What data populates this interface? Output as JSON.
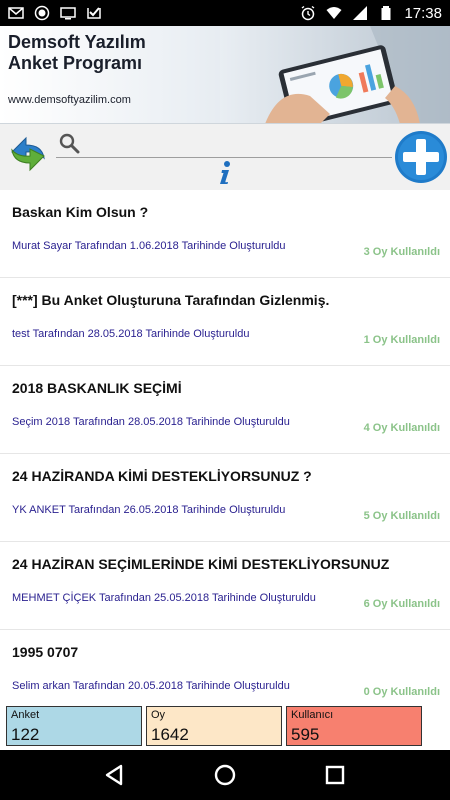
{
  "status_bar": {
    "time": "17:38"
  },
  "banner": {
    "title_line1": "Demsoft Yazılım",
    "title_line2": "Anket Programı",
    "url": "www.demsoftyazilim.com"
  },
  "search": {
    "placeholder": ""
  },
  "surveys": [
    {
      "title": "Baskan Kim Olsun ?",
      "subtitle": "Murat Sayar Tarafından 1.06.2018 Tarihinde Oluşturuldu",
      "votes": "3 Oy Kullanıldı"
    },
    {
      "title": "[***] Bu Anket Oluşturuna Tarafından Gizlenmiş.",
      "subtitle": "test Tarafından 28.05.2018 Tarihinde Oluşturuldu",
      "votes": "1 Oy Kullanıldı"
    },
    {
      "title": "2018 BASKANLIK SEÇİMİ",
      "subtitle": "Seçim  2018 Tarafından 28.05.2018 Tarihinde Oluşturuldu",
      "votes": "4 Oy Kullanıldı"
    },
    {
      "title": "24 HAZİRANDA KİMİ DESTEKLİYORSUNUZ ?",
      "subtitle": "YK ANKET Tarafından 26.05.2018 Tarihinde Oluşturuldu",
      "votes": "5 Oy Kullanıldı"
    },
    {
      "title": "24 HAZİRAN SEÇİMLERİNDE KİMİ DESTEKLİYORSUNUZ",
      "subtitle": "MEHMET ÇİÇEK  Tarafından 25.05.2018 Tarihinde Oluşturuldu",
      "votes": "6 Oy Kullanıldı"
    },
    {
      "title": "1995 0707",
      "subtitle": "Selim arkan  Tarafından 20.05.2018 Tarihinde Oluşturuldu",
      "votes": "0 Oy Kullanıldı"
    }
  ],
  "stats": [
    {
      "label": "Anket",
      "value": "122",
      "color": "#add8e6"
    },
    {
      "label": "Oy",
      "value": "1642",
      "color": "#fde7c7"
    },
    {
      "label": "Kullanıcı",
      "value": "595",
      "color": "#f7806f"
    }
  ],
  "colors": {
    "subtitle": "#2b2290",
    "votes": "#8bc389",
    "add_button": "#1f7bc9",
    "refresh_blue": "#2c7fc9",
    "refresh_green": "#5fae3a"
  },
  "icons": {
    "status_left": [
      "gmail-icon",
      "record-icon",
      "screen-icon",
      "checkmark-app-icon"
    ],
    "status_right": [
      "alarm-icon",
      "wifi-icon",
      "signal-icon",
      "battery-icon"
    ],
    "toolbar": [
      "refresh-icon",
      "search-icon",
      "info-icon",
      "add-icon"
    ],
    "nav": [
      "back-icon",
      "home-icon",
      "recents-icon"
    ]
  }
}
